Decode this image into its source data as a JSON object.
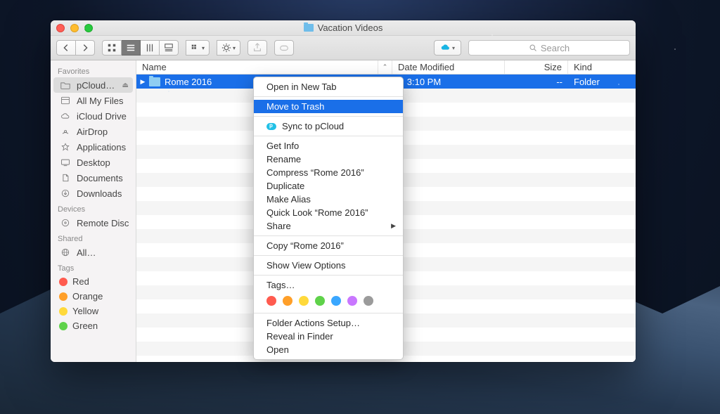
{
  "window": {
    "title": "Vacation Videos"
  },
  "toolbar": {
    "search_placeholder": "Search"
  },
  "sidebar": {
    "sections": {
      "favorites": {
        "label": "Favorites",
        "items": [
          {
            "label": "pCloud…"
          },
          {
            "label": "All My Files"
          },
          {
            "label": "iCloud Drive"
          },
          {
            "label": "AirDrop"
          },
          {
            "label": "Applications"
          },
          {
            "label": "Desktop"
          },
          {
            "label": "Documents"
          },
          {
            "label": "Downloads"
          }
        ]
      },
      "devices": {
        "label": "Devices",
        "items": [
          {
            "label": "Remote Disc"
          }
        ]
      },
      "shared": {
        "label": "Shared",
        "items": [
          {
            "label": "All…"
          }
        ]
      },
      "tags": {
        "label": "Tags",
        "items": [
          {
            "label": "Red",
            "color": "#ff5b4f"
          },
          {
            "label": "Orange",
            "color": "#ff9f29"
          },
          {
            "label": "Yellow",
            "color": "#ffd93b"
          },
          {
            "label": "Green",
            "color": "#5fd24a"
          }
        ]
      }
    }
  },
  "columns": {
    "name": "Name",
    "date": "Date Modified",
    "size": "Size",
    "kind": "Kind"
  },
  "files": [
    {
      "name": "Rome 2016",
      "date_visible": "y, 3:10 PM",
      "size": "--",
      "kind": "Folder"
    }
  ],
  "context_menu": {
    "groups": [
      [
        {
          "label": "Open in New Tab"
        }
      ],
      [
        {
          "label": "Move to Trash",
          "highlight": true
        }
      ],
      [
        {
          "label": "Sync to pCloud",
          "icon": "pcloud"
        }
      ],
      [
        {
          "label": "Get Info"
        },
        {
          "label": "Rename"
        },
        {
          "label": "Compress “Rome 2016”"
        },
        {
          "label": "Duplicate"
        },
        {
          "label": "Make Alias"
        },
        {
          "label": "Quick Look “Rome 2016”"
        },
        {
          "label": "Share",
          "submenu": true
        }
      ],
      [
        {
          "label": "Copy “Rome 2016”"
        }
      ],
      [
        {
          "label": "Show View Options"
        }
      ],
      [
        {
          "label": "Tags…"
        },
        {
          "tag_colors": [
            "#ff5b4f",
            "#ff9f29",
            "#ffd93b",
            "#5fd24a",
            "#3aa7ff",
            "#c977ff",
            "#9b9b9b"
          ]
        }
      ],
      [
        {
          "label": "Folder Actions Setup…"
        },
        {
          "label": "Reveal in Finder"
        },
        {
          "label": "Open"
        }
      ]
    ]
  }
}
